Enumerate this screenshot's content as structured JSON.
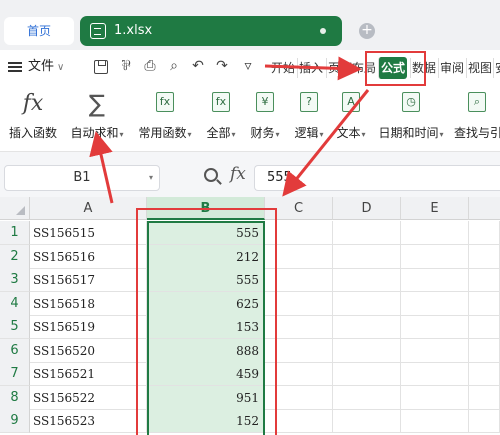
{
  "titlebar": {
    "home_tab": "首页",
    "file_tab": "1.xlsx",
    "add_tab_icon": "+"
  },
  "menubar": {
    "file_menu": "文件",
    "quick_access": [
      "save-icon",
      "format-painter-icon",
      "print-icon",
      "print-preview-icon",
      "undo-icon",
      "redo-icon",
      "more-icon"
    ],
    "ribbon_tabs": [
      "开始",
      "插入",
      "页面布局",
      "公式",
      "数据",
      "审阅",
      "视图",
      "安"
    ],
    "active_tab": "公式"
  },
  "toolbar": {
    "buttons": [
      {
        "label": "插入函数",
        "icon": "fx-icon"
      },
      {
        "label": "自动求和",
        "icon": "sigma-icon"
      },
      {
        "label": "常用函数",
        "icon": "common-function-icon"
      },
      {
        "label": "全部",
        "icon": "all-functions-icon"
      },
      {
        "label": "财务",
        "icon": "finance-icon"
      },
      {
        "label": "逻辑",
        "icon": "logic-icon"
      },
      {
        "label": "文本",
        "icon": "text-function-icon"
      },
      {
        "label": "日期和时间",
        "icon": "date-time-icon"
      },
      {
        "label": "查找与引",
        "icon": "lookup-icon"
      }
    ]
  },
  "formula_bar": {
    "name_box": "B1",
    "fx_label": "fx",
    "value": "555"
  },
  "grid": {
    "columns": [
      "A",
      "B",
      "C",
      "D",
      "E"
    ],
    "selected_column": "B",
    "rows": [
      {
        "num": "1",
        "a": "SS156515",
        "b": "555"
      },
      {
        "num": "2",
        "a": "SS156516",
        "b": "212"
      },
      {
        "num": "3",
        "a": "SS156517",
        "b": "555"
      },
      {
        "num": "4",
        "a": "SS156518",
        "b": "625"
      },
      {
        "num": "5",
        "a": "SS156519",
        "b": "153"
      },
      {
        "num": "6",
        "a": "SS156520",
        "b": "888"
      },
      {
        "num": "7",
        "a": "SS156521",
        "b": "459"
      },
      {
        "num": "8",
        "a": "SS156522",
        "b": "951"
      },
      {
        "num": "9",
        "a": "SS156523",
        "b": "152"
      }
    ]
  },
  "colors": {
    "accent": "#1f7a43",
    "selection_fill": "#dcefe1",
    "annotation_red": "#e23b3b"
  }
}
